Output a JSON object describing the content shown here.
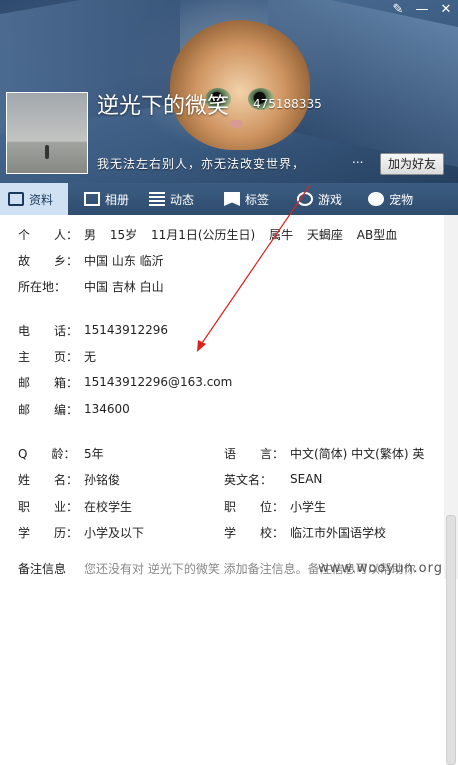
{
  "header": {
    "nickname": "逆光下的微笑",
    "qq_number": "475188335",
    "signature": "我无法左右别人，亦无法改变世界，",
    "signature_more": "...",
    "add_friend_label": "加为好友",
    "window_controls": [
      "brush-icon",
      "minimize-icon",
      "close-icon"
    ]
  },
  "tabs": [
    {
      "label": "资料",
      "icon": "card-icon"
    },
    {
      "label": "相册",
      "icon": "photo-icon"
    },
    {
      "label": "动态",
      "icon": "list-icon"
    },
    {
      "label": "标签",
      "icon": "tag-icon"
    },
    {
      "label": "游戏",
      "icon": "game-icon"
    },
    {
      "label": "宠物",
      "icon": "pet-icon"
    }
  ],
  "profile": {
    "person_label": "个　　人：",
    "gender": "男",
    "age": "15岁",
    "birthday": "11月1日(公历生日)",
    "zodiac": "属牛",
    "constellation": "天蝎座",
    "blood": "AB型血",
    "hometown_label": "故　　乡：",
    "hometown": "中国 山东 临沂",
    "location_label": "所在地：",
    "location": "中国 吉林 白山",
    "phone_label": "电　　话：",
    "phone": "15143912296",
    "homepage_label": "主　　页：",
    "homepage": "无",
    "email_label": "邮　　箱：",
    "email": "15143912296@163.com",
    "zip_label": "邮　　编：",
    "zip": "134600",
    "qage_label": "Q　　龄：",
    "qage": "5年",
    "lang_label": "语　　言：",
    "lang": "中文(简体)  中文(繁体)  英",
    "name_label": "姓　　名：",
    "name": "孙铭俊",
    "en_name_label": "英文名：",
    "en_name": "SEAN",
    "job_label": "职　　业：",
    "job": "在校学生",
    "position_label": "职　　位：",
    "position": "小学生",
    "edu_label": "学　　历：",
    "edu": "小学及以下",
    "school_label": "学　　校：",
    "school": "临江市外国语学校",
    "remark_label": "备注信息",
    "remark": "您还没有对 逆光下的微笑 添加备注信息。备注信息可以帮助你"
  },
  "watermark": "www.wooyun.org",
  "accent": "#3c5d82"
}
